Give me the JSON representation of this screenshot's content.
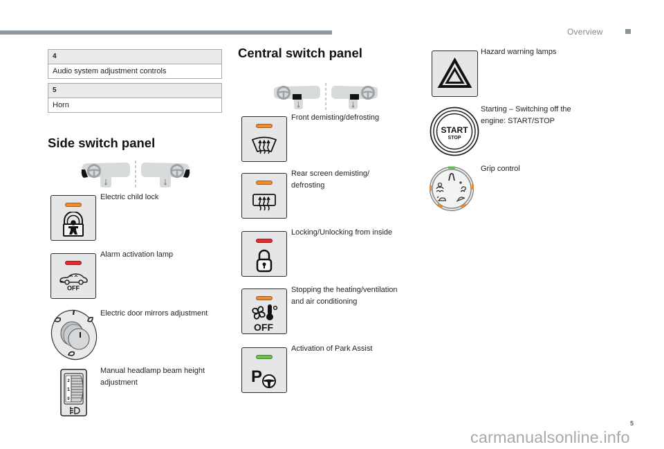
{
  "header": {
    "section_title": "Overview",
    "end_marker_icon": "square"
  },
  "tables": [
    {
      "number": "4",
      "label": "Audio system adjustment controls"
    },
    {
      "number": "5",
      "label": "Horn"
    }
  ],
  "side_switch_panel": {
    "title": "Side switch panel",
    "location_diagram": "dashboard-side-panels-highlighted",
    "items": [
      {
        "label": "Electric child lock",
        "icon": "child-lock-icon",
        "indicator": "orange"
      },
      {
        "label": "Alarm activation lamp",
        "icon": "alarm-off-icon",
        "indicator": "red",
        "icon_text": "OFF"
      },
      {
        "label": "Electric door mirrors adjustment",
        "icon": "door-mirror-dial-icon"
      },
      {
        "label": "Manual headlamp beam height\nadjustment",
        "icon": "headlamp-height-wheel-icon",
        "scale": [
          "2",
          "1",
          "0"
        ]
      }
    ]
  },
  "central_switch_panel": {
    "title": "Central switch panel",
    "location_diagram": "dashboard-central-panel-highlighted",
    "items": [
      {
        "label": "Front demisting/defrosting",
        "icon": "front-demist-icon",
        "indicator": "orange"
      },
      {
        "label": "Rear screen demisting/\ndefrosting",
        "icon": "rear-demist-icon",
        "indicator": "orange"
      },
      {
        "label": "Locking/Unlocking from inside",
        "icon": "lock-icon",
        "indicator": "red"
      },
      {
        "label": "Stopping the heating/ventilation\nand air conditioning",
        "icon": "fan-thermometer-off-icon",
        "indicator": "orange",
        "icon_text": "OFF"
      },
      {
        "label": "Activation of Park Assist",
        "icon": "park-assist-icon",
        "indicator": "green",
        "icon_text": "P"
      }
    ]
  },
  "right_column": {
    "items": [
      {
        "label": "Hazard warning lamps",
        "icon": "hazard-triangle-icon"
      },
      {
        "label": "Starting – Switching off the\nengine: START/STOP",
        "icon": "start-stop-button-icon",
        "icon_text": "START",
        "icon_subtext": "STOP"
      },
      {
        "label": "Grip control",
        "icon": "grip-control-dial-icon"
      }
    ]
  },
  "page_number": "5",
  "watermark": "carmanualsonline.info",
  "colors": {
    "orange": "#f28a2e",
    "red": "#e52a2d",
    "green": "#6cc34b",
    "switch_face": "#e4e6e7",
    "header_bar": "#8e979e",
    "header_text": "#7b8a8e"
  }
}
